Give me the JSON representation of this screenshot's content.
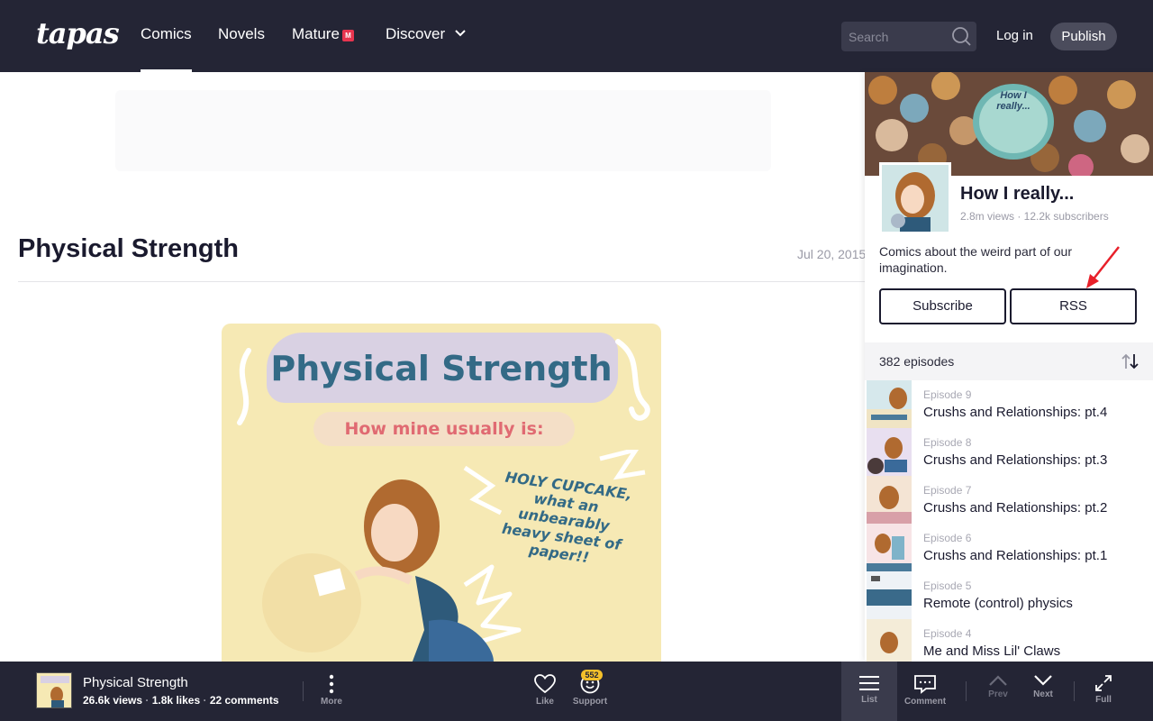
{
  "header": {
    "logo": "tapas",
    "nav": [
      {
        "label": "Comics",
        "active": true
      },
      {
        "label": "Novels"
      },
      {
        "label": "Mature",
        "badge": "M"
      },
      {
        "label": "Discover"
      }
    ],
    "search_placeholder": "Search",
    "login_label": "Log in",
    "publish_label": "Publish"
  },
  "episode": {
    "title": "Physical Strength",
    "date": "Jul 20, 2015"
  },
  "comic": {
    "title": "Physical Strength",
    "subtitle": "How mine usually is:",
    "bubble": "HOLY CUPCAKE, what an unbearably heavy sheet of paper!!"
  },
  "series": {
    "title": "How I really...",
    "stats": "2.8m views · 12.2k subscribers",
    "description": "Comics about the weird part of our imagination.",
    "subscribe_label": "Subscribe",
    "rss_label": "RSS",
    "episode_count": "382 episodes",
    "cover_text": "How I really..."
  },
  "episodes": [
    {
      "num": "Episode 9",
      "name": "Crushs and Relationships: pt.4"
    },
    {
      "num": "Episode 8",
      "name": "Crushs and Relationships: pt.3"
    },
    {
      "num": "Episode 7",
      "name": "Crushs and Relationships: pt.2"
    },
    {
      "num": "Episode 6",
      "name": "Crushs and Relationships: pt.1"
    },
    {
      "num": "Episode 5",
      "name": "Remote (control) physics"
    },
    {
      "num": "Episode 4",
      "name": "Me and Miss Lil' Claws"
    }
  ],
  "bottom_bar": {
    "title": "Physical Strength",
    "views": "26.6k views",
    "likes": "1.8k likes",
    "comments": "22 comments",
    "more_label": "More",
    "like_label": "Like",
    "support_label": "Support",
    "support_badge": "552",
    "list_label": "List",
    "comment_label": "Comment",
    "prev_label": "Prev",
    "next_label": "Next",
    "full_label": "Full"
  },
  "colors": {
    "header_bg": "#242535",
    "accent_red": "#e8354f",
    "annotation_arrow": "#e8202a",
    "badge_yellow": "#f4c02a"
  }
}
